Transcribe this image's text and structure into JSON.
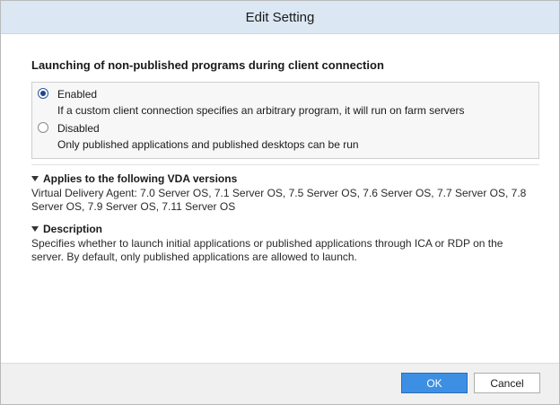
{
  "dialog": {
    "title": "Edit Setting"
  },
  "setting": {
    "heading": "Launching of non-published programs during client connection",
    "options": [
      {
        "label": "Enabled",
        "description": "If a custom client connection specifies an arbitrary program, it will run on farm servers",
        "selected": true
      },
      {
        "label": "Disabled",
        "description": "Only published applications and published desktops can be run",
        "selected": false
      }
    ]
  },
  "sections": [
    {
      "title": "Applies to the following VDA versions",
      "body": "Virtual Delivery Agent: 7.0 Server OS, 7.1 Server OS, 7.5 Server OS, 7.6 Server OS, 7.7 Server OS, 7.8 Server OS, 7.9 Server OS, 7.11 Server OS",
      "expanded": true
    },
    {
      "title": "Description",
      "body": "Specifies whether to launch initial applications or published applications  through ICA or RDP on the server. By default, only published applications are allowed to launch.",
      "expanded": true
    }
  ],
  "buttons": {
    "ok": "OK",
    "cancel": "Cancel"
  },
  "colors": {
    "titlebar": "#dbe7f3",
    "ok_button": "#3c8fe3",
    "footer": "#f0f0f0"
  }
}
